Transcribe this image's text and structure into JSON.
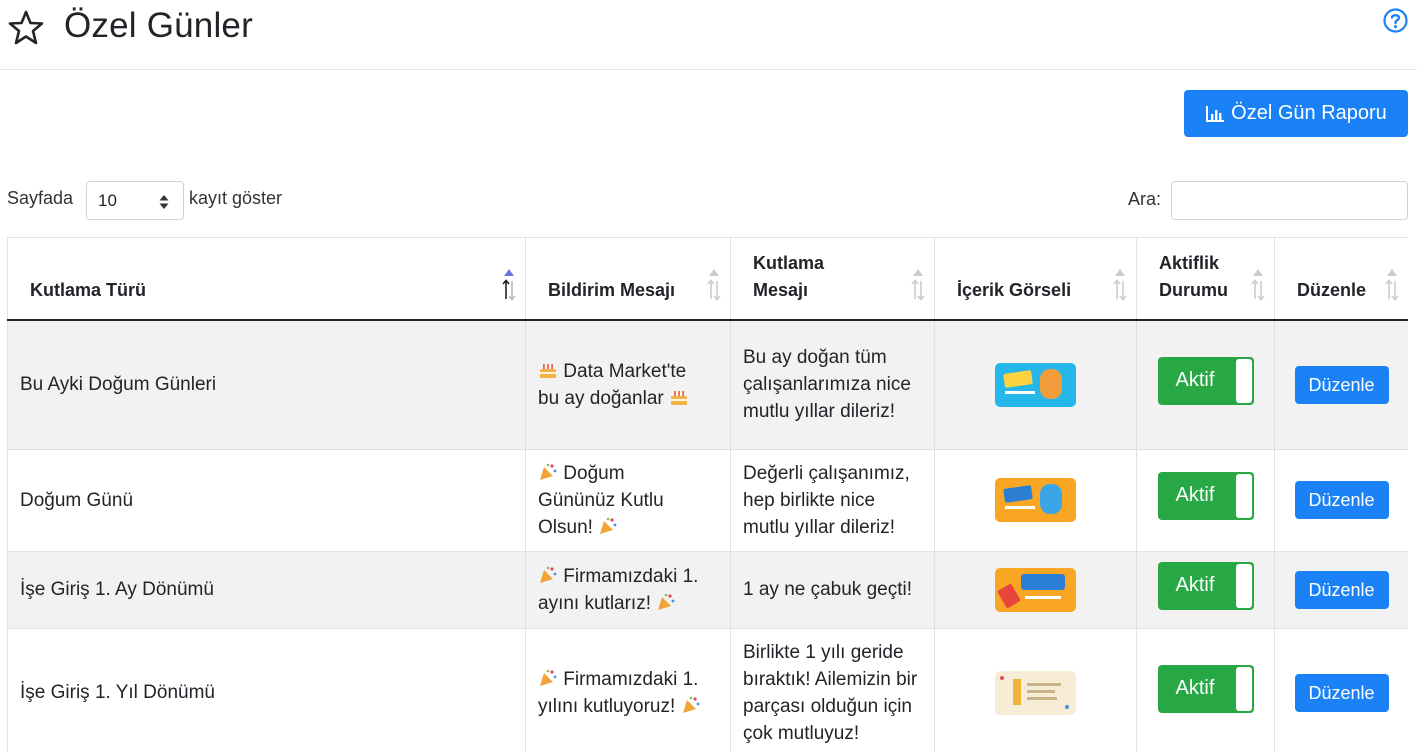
{
  "header": {
    "title": "Özel Günler",
    "title_icon": "star-icon",
    "help_icon": "question-circle-icon"
  },
  "toolbar": {
    "report_label": "Özel Gün Raporu",
    "report_icon": "bar-chart-icon"
  },
  "length": {
    "label_before": "Sayfada",
    "value": "10",
    "label_after": "kayıt göster"
  },
  "search": {
    "label": "Ara:",
    "value": ""
  },
  "colors": {
    "primary": "#1a82f6",
    "success": "#28a745",
    "stripe": "#f2f2f2",
    "sort_active": "#6c7ae0"
  },
  "table": {
    "columns": [
      {
        "line1": "Kutlama Türü",
        "line2": ""
      },
      {
        "line1": "Bildirim Mesajı",
        "line2": ""
      },
      {
        "line1": "Kutlama",
        "line2": "Mesajı"
      },
      {
        "line1": "İçerik Görseli",
        "line2": ""
      },
      {
        "line1": "Aktiflik",
        "line2": "Durumu"
      },
      {
        "line1": "Düzenle",
        "line2": ""
      }
    ],
    "rows": [
      {
        "type": "Bu Ayki Doğum Günleri",
        "notif_emoji": "cake-icon",
        "notif_line1": "Data Market'te",
        "notif_line2": "bu ay doğanlar",
        "notif_line3": "",
        "message": "Bu ay doğan tüm çalışanlarımıza nice mutlu yıllar dileriz!",
        "image": "happy-birthday-banner-blue",
        "status": "Aktif",
        "edit": "Düzenle"
      },
      {
        "type": "Doğum Günü",
        "notif_emoji": "party-popper-icon",
        "notif_line1": "Doğum",
        "notif_line2": "Gününüz Kutlu",
        "notif_line3": "Olsun!",
        "message": "Değerli çalışanımız, hep birlikte nice mutlu yıllar dileriz!",
        "image": "happy-birthday-banner-orange",
        "status": "Aktif",
        "edit": "Düzenle"
      },
      {
        "type": "İşe Giriş 1. Ay Dönümü",
        "notif_emoji": "party-popper-icon",
        "notif_line1": "Firmamızdaki 1.",
        "notif_line2": "ayını kutlarız!",
        "notif_line3": "",
        "message": "1 ay ne çabuk geçti!",
        "image": "first-month-banner",
        "status": "Aktif",
        "edit": "Düzenle"
      },
      {
        "type": "İşe Giriş 1. Yıl Dönümü",
        "notif_emoji": "party-popper-icon",
        "notif_line1": "Firmamızdaki 1.",
        "notif_line2": "yılını kutluyoruz!",
        "notif_line3": "",
        "message": "Birlikte 1 yılı geride bıraktık! Ailemizin bir parçası olduğun için çok mutluyuz!",
        "image": "first-year-banner",
        "status": "Aktif",
        "edit": "Düzenle"
      }
    ]
  }
}
